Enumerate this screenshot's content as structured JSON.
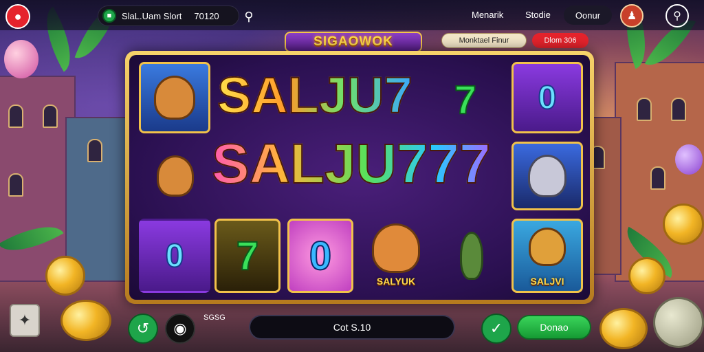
{
  "header": {
    "site_name": "SlaL.Uam Slort",
    "site_code": "70120",
    "nav": [
      "Menarik",
      "Stodie"
    ],
    "nav_pill": "Oonur"
  },
  "banner": {
    "title": "SIGAOWOK",
    "info_pill": "Monktael Finur",
    "red_pill": "Dlom 306"
  },
  "reels": {
    "big_line_1": "SALJU7",
    "big_line_2": "SALJU777",
    "symbol_seven": "7",
    "symbol_zero": "0",
    "symbol_box_number": "0",
    "caption_dog": "SALYUK",
    "caption_badge": "SALJVI"
  },
  "controls": {
    "mini_logo": "SGSG",
    "bet_value": "Cot S.10",
    "deal_label": "Donao"
  },
  "colors": {
    "accent_red": "#e5232c",
    "accent_green": "#1ea54a",
    "frame_gold": "#f1c24a",
    "reel_purple": "#2a1050"
  },
  "icons": [
    "logo-icon",
    "site-icon",
    "search-icon",
    "user-icon",
    "key-icon",
    "refresh-icon",
    "camera-icon",
    "spin-icon",
    "corner-tool-icon"
  ]
}
